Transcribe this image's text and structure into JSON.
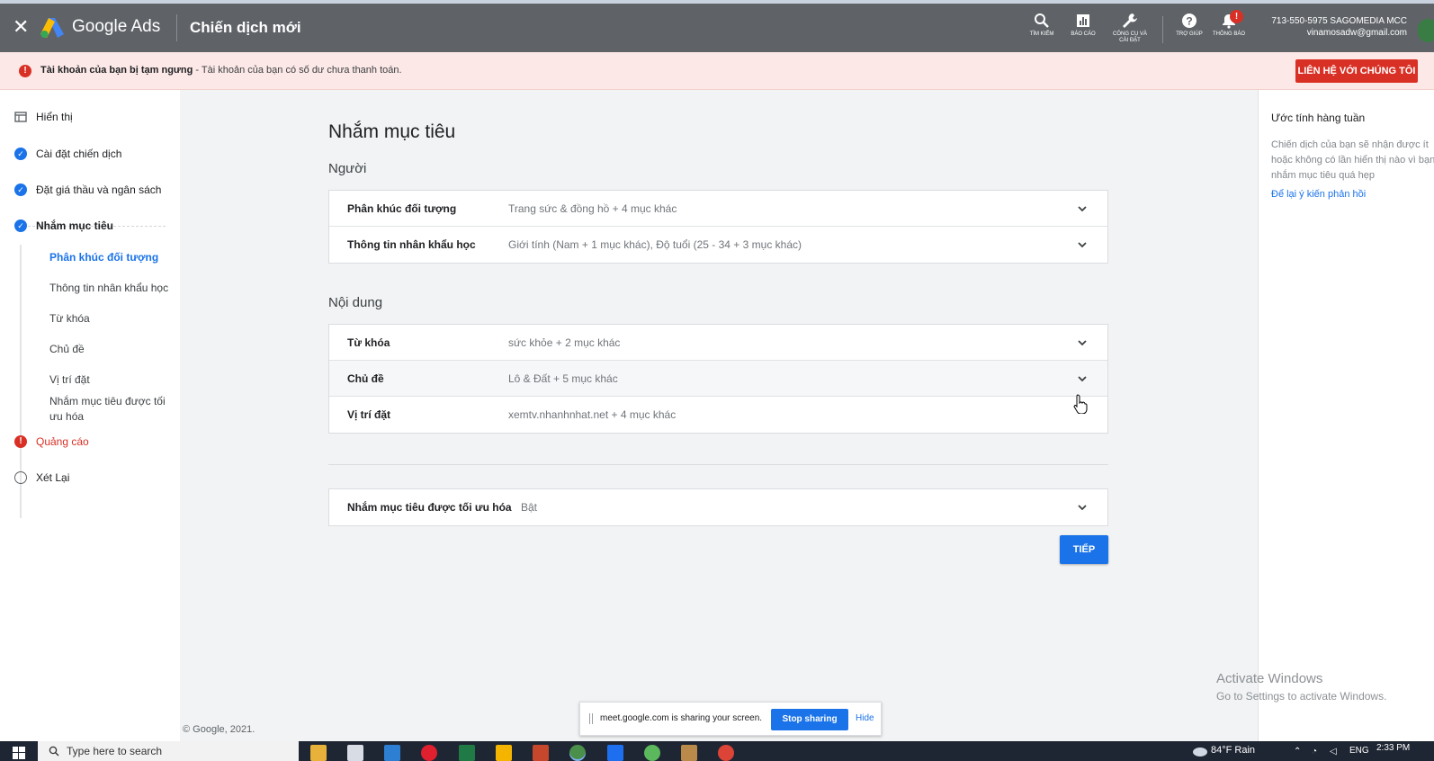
{
  "topbar": {
    "close_glyph": "✕",
    "brand": "Google Ads",
    "page_title": "Chiến dịch mới",
    "tools": [
      {
        "label": "TÌM KIẾM",
        "icon": "search-icon"
      },
      {
        "label": "BÁO CÁO",
        "icon": "bar-chart-icon"
      },
      {
        "label": "CÔNG CỤ VÀ CÀI ĐẶT",
        "icon": "wrench-icon"
      },
      {
        "label": "TRỢ GIÚP",
        "icon": "help-icon"
      },
      {
        "label": "THÔNG BÁO",
        "icon": "bell-icon"
      }
    ],
    "notification_badge": "!",
    "account_line1": "713-550-5975 SAGOMEDIA MCC",
    "account_line2": "vinamosadw@gmail.com"
  },
  "alert": {
    "icon_glyph": "!",
    "bold_text": "Tài khoản của bạn bị tạm ngưng",
    "text": " - Tài khoản của bạn có số dư chưa thanh toán.",
    "button": "LIÊN HỆ VỚI CHÚNG TÔI"
  },
  "sidebar": {
    "display": "Hiển thị",
    "items": [
      {
        "label": "Cài đặt chiến dịch",
        "status": "done"
      },
      {
        "label": "Đặt giá thầu và ngân sách",
        "status": "done"
      },
      {
        "label": "Nhắm mục tiêu",
        "status": "current"
      },
      {
        "label": "Quảng cáo",
        "status": "error"
      },
      {
        "label": "Xét Lại",
        "status": "todo"
      }
    ],
    "sub_items": [
      "Phân khúc đối tượng",
      "Thông tin nhân khẩu học",
      "Từ khóa",
      "Chủ đề",
      "Vị trí đặt",
      "Nhắm mục tiêu được tối ưu hóa"
    ],
    "check_glyph": "✓",
    "error_glyph": "!"
  },
  "main": {
    "title": "Nhắm mục tiêu",
    "people_section": "Người",
    "people_rows": [
      {
        "label": "Phân khúc đối tượng",
        "value": "Trang sức & đồng hồ + 4 mục khác"
      },
      {
        "label": "Thông tin nhân khẩu học",
        "value": "Giới tính (Nam + 1 mục khác), Độ tuổi (25 - 34 + 3 mục khác)"
      }
    ],
    "content_section": "Nội dung",
    "content_rows": [
      {
        "label": "Từ khóa",
        "value": "sức khỏe + 2 mục khác"
      },
      {
        "label": "Chủ đề",
        "value": "Lô & Đất + 5 mục khác"
      },
      {
        "label": "Vị trí đặt",
        "value": "xemtv.nhanhnhat.net + 4 mục khác"
      }
    ],
    "optimized_row": {
      "label": "Nhắm mục tiêu được tối ưu hóa",
      "value": "Bật"
    },
    "next_button": "TIẾP",
    "copyright": "© Google, 2021."
  },
  "right_panel": {
    "title": "Ước tính hàng tuần",
    "text": "Chiến dịch của bạn sẽ nhận được ít hoặc không có lần hiển thị nào vì bạn nhắm mục tiêu quá hẹp",
    "link": "Để lại ý kiến phản hồi"
  },
  "watermark": {
    "line1": "Activate Windows",
    "line2": "Go to Settings to activate Windows."
  },
  "screenshare": {
    "text": "meet.google.com is sharing your screen.",
    "stop": "Stop sharing",
    "hide": "Hide"
  },
  "taskbar": {
    "search_placeholder": "Type here to search",
    "apps": [
      "file-explorer",
      "store",
      "mail",
      "opera",
      "excel",
      "google-ads",
      "powerpoint",
      "chrome",
      "zalo",
      "coccoc",
      "paint",
      "chrome"
    ],
    "weather": "84°F  Rain",
    "lang": "ENG",
    "time": "2:33 PM"
  },
  "colors": {
    "accent": "#1a73e8",
    "error": "#d93025",
    "topbar": "#5f6368",
    "alert_bg": "#fce8e6"
  }
}
